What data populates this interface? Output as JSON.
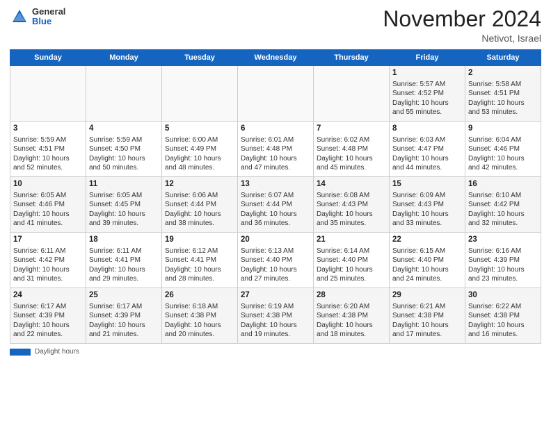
{
  "header": {
    "logo_general": "General",
    "logo_blue": "Blue",
    "month_title": "November 2024",
    "location": "Netivot, Israel"
  },
  "footer": {
    "daylight_label": "Daylight hours"
  },
  "days_of_week": [
    "Sunday",
    "Monday",
    "Tuesday",
    "Wednesday",
    "Thursday",
    "Friday",
    "Saturday"
  ],
  "weeks": [
    [
      {
        "day": "",
        "info": ""
      },
      {
        "day": "",
        "info": ""
      },
      {
        "day": "",
        "info": ""
      },
      {
        "day": "",
        "info": ""
      },
      {
        "day": "",
        "info": ""
      },
      {
        "day": "1",
        "info": "Sunrise: 5:57 AM\nSunset: 4:52 PM\nDaylight: 10 hours and 55 minutes."
      },
      {
        "day": "2",
        "info": "Sunrise: 5:58 AM\nSunset: 4:51 PM\nDaylight: 10 hours and 53 minutes."
      }
    ],
    [
      {
        "day": "3",
        "info": "Sunrise: 5:59 AM\nSunset: 4:51 PM\nDaylight: 10 hours and 52 minutes."
      },
      {
        "day": "4",
        "info": "Sunrise: 5:59 AM\nSunset: 4:50 PM\nDaylight: 10 hours and 50 minutes."
      },
      {
        "day": "5",
        "info": "Sunrise: 6:00 AM\nSunset: 4:49 PM\nDaylight: 10 hours and 48 minutes."
      },
      {
        "day": "6",
        "info": "Sunrise: 6:01 AM\nSunset: 4:48 PM\nDaylight: 10 hours and 47 minutes."
      },
      {
        "day": "7",
        "info": "Sunrise: 6:02 AM\nSunset: 4:48 PM\nDaylight: 10 hours and 45 minutes."
      },
      {
        "day": "8",
        "info": "Sunrise: 6:03 AM\nSunset: 4:47 PM\nDaylight: 10 hours and 44 minutes."
      },
      {
        "day": "9",
        "info": "Sunrise: 6:04 AM\nSunset: 4:46 PM\nDaylight: 10 hours and 42 minutes."
      }
    ],
    [
      {
        "day": "10",
        "info": "Sunrise: 6:05 AM\nSunset: 4:46 PM\nDaylight: 10 hours and 41 minutes."
      },
      {
        "day": "11",
        "info": "Sunrise: 6:05 AM\nSunset: 4:45 PM\nDaylight: 10 hours and 39 minutes."
      },
      {
        "day": "12",
        "info": "Sunrise: 6:06 AM\nSunset: 4:44 PM\nDaylight: 10 hours and 38 minutes."
      },
      {
        "day": "13",
        "info": "Sunrise: 6:07 AM\nSunset: 4:44 PM\nDaylight: 10 hours and 36 minutes."
      },
      {
        "day": "14",
        "info": "Sunrise: 6:08 AM\nSunset: 4:43 PM\nDaylight: 10 hours and 35 minutes."
      },
      {
        "day": "15",
        "info": "Sunrise: 6:09 AM\nSunset: 4:43 PM\nDaylight: 10 hours and 33 minutes."
      },
      {
        "day": "16",
        "info": "Sunrise: 6:10 AM\nSunset: 4:42 PM\nDaylight: 10 hours and 32 minutes."
      }
    ],
    [
      {
        "day": "17",
        "info": "Sunrise: 6:11 AM\nSunset: 4:42 PM\nDaylight: 10 hours and 31 minutes."
      },
      {
        "day": "18",
        "info": "Sunrise: 6:11 AM\nSunset: 4:41 PM\nDaylight: 10 hours and 29 minutes."
      },
      {
        "day": "19",
        "info": "Sunrise: 6:12 AM\nSunset: 4:41 PM\nDaylight: 10 hours and 28 minutes."
      },
      {
        "day": "20",
        "info": "Sunrise: 6:13 AM\nSunset: 4:40 PM\nDaylight: 10 hours and 27 minutes."
      },
      {
        "day": "21",
        "info": "Sunrise: 6:14 AM\nSunset: 4:40 PM\nDaylight: 10 hours and 25 minutes."
      },
      {
        "day": "22",
        "info": "Sunrise: 6:15 AM\nSunset: 4:40 PM\nDaylight: 10 hours and 24 minutes."
      },
      {
        "day": "23",
        "info": "Sunrise: 6:16 AM\nSunset: 4:39 PM\nDaylight: 10 hours and 23 minutes."
      }
    ],
    [
      {
        "day": "24",
        "info": "Sunrise: 6:17 AM\nSunset: 4:39 PM\nDaylight: 10 hours and 22 minutes."
      },
      {
        "day": "25",
        "info": "Sunrise: 6:17 AM\nSunset: 4:39 PM\nDaylight: 10 hours and 21 minutes."
      },
      {
        "day": "26",
        "info": "Sunrise: 6:18 AM\nSunset: 4:38 PM\nDaylight: 10 hours and 20 minutes."
      },
      {
        "day": "27",
        "info": "Sunrise: 6:19 AM\nSunset: 4:38 PM\nDaylight: 10 hours and 19 minutes."
      },
      {
        "day": "28",
        "info": "Sunrise: 6:20 AM\nSunset: 4:38 PM\nDaylight: 10 hours and 18 minutes."
      },
      {
        "day": "29",
        "info": "Sunrise: 6:21 AM\nSunset: 4:38 PM\nDaylight: 10 hours and 17 minutes."
      },
      {
        "day": "30",
        "info": "Sunrise: 6:22 AM\nSunset: 4:38 PM\nDaylight: 10 hours and 16 minutes."
      }
    ]
  ]
}
